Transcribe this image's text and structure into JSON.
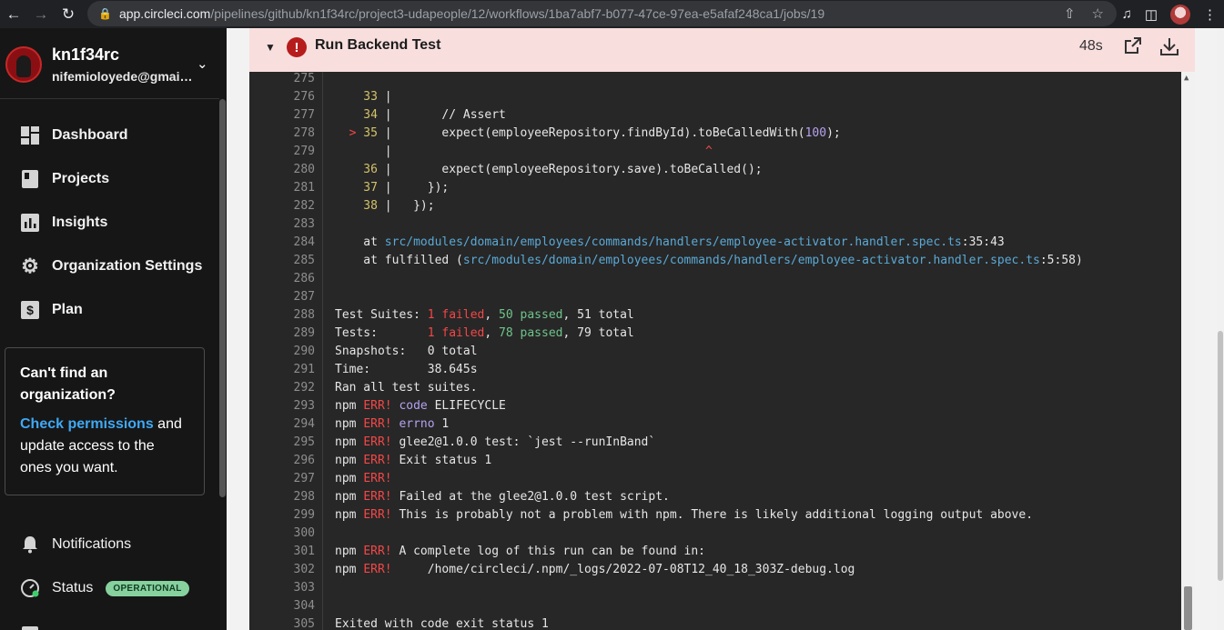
{
  "browser": {
    "url_host": "app.circleci.com",
    "url_path": "/pipelines/github/kn1f34rc/project3-udapeople/12/workflows/1ba7abf7-b077-47ce-97ea-e5afaf248ca1/jobs/19"
  },
  "sidebar": {
    "user_name": "kn1f34rc",
    "user_email": "nifemioloyede@gmail...",
    "nav": {
      "dashboard": "Dashboard",
      "projects": "Projects",
      "insights": "Insights",
      "org_settings": "Organization Settings",
      "plan": "Plan",
      "notifications": "Notifications",
      "status": "Status"
    },
    "org_box": {
      "heading": "Can't find an organization?",
      "link": "Check permissions",
      "text": " and update access to the ones you want."
    },
    "status_badge": "OPERATIONAL"
  },
  "job": {
    "title": "Run Backend Test",
    "duration": "48s"
  },
  "log": [
    {
      "n": "275",
      "segs": [
        {
          "t": ""
        }
      ]
    },
    {
      "n": "276",
      "segs": [
        {
          "t": "    33 ",
          "c": "c-yellow"
        },
        {
          "t": "|",
          "c": "c-dim"
        }
      ]
    },
    {
      "n": "277",
      "segs": [
        {
          "t": "    34 ",
          "c": "c-yellow"
        },
        {
          "t": "|",
          "c": "c-dim"
        },
        {
          "t": "       // Assert"
        }
      ]
    },
    {
      "n": "278",
      "segs": [
        {
          "t": "  ",
          "c": ""
        },
        {
          "t": ">",
          "c": "c-red"
        },
        {
          "t": " 35 ",
          "c": "c-yellow"
        },
        {
          "t": "|",
          "c": "c-dim"
        },
        {
          "t": "       expect(employeeRepository.findById).toBeCalledWith("
        },
        {
          "t": "100",
          "c": "c-purple"
        },
        {
          "t": ");"
        }
      ]
    },
    {
      "n": "279",
      "segs": [
        {
          "t": "       |",
          "c": "c-dim"
        },
        {
          "t": "                                            "
        },
        {
          "t": "^",
          "c": "c-red"
        }
      ]
    },
    {
      "n": "280",
      "segs": [
        {
          "t": "    36 ",
          "c": "c-yellow"
        },
        {
          "t": "|",
          "c": "c-dim"
        },
        {
          "t": "       expect(employeeRepository.save).toBeCalled();"
        }
      ]
    },
    {
      "n": "281",
      "segs": [
        {
          "t": "    37 ",
          "c": "c-yellow"
        },
        {
          "t": "|",
          "c": "c-dim"
        },
        {
          "t": "     });"
        }
      ]
    },
    {
      "n": "282",
      "segs": [
        {
          "t": "    38 ",
          "c": "c-yellow"
        },
        {
          "t": "|",
          "c": "c-dim"
        },
        {
          "t": "   });"
        }
      ]
    },
    {
      "n": "283",
      "segs": [
        {
          "t": ""
        }
      ]
    },
    {
      "n": "284",
      "segs": [
        {
          "t": "    at "
        },
        {
          "t": "src/modules/domain/employees/commands/handlers/employee-activator.handler.spec.ts",
          "c": "c-blue"
        },
        {
          "t": ":35:43"
        }
      ]
    },
    {
      "n": "285",
      "segs": [
        {
          "t": "    at fulfilled ("
        },
        {
          "t": "src/modules/domain/employees/commands/handlers/employee-activator.handler.spec.ts",
          "c": "c-blue"
        },
        {
          "t": ":5:58)"
        }
      ]
    },
    {
      "n": "286",
      "segs": [
        {
          "t": ""
        }
      ]
    },
    {
      "n": "287",
      "segs": [
        {
          "t": ""
        }
      ]
    },
    {
      "n": "288",
      "segs": [
        {
          "t": "Test Suites: "
        },
        {
          "t": "1 failed",
          "c": "c-red"
        },
        {
          "t": ", "
        },
        {
          "t": "50 passed",
          "c": "c-green"
        },
        {
          "t": ", 51 total"
        }
      ]
    },
    {
      "n": "289",
      "segs": [
        {
          "t": "Tests:       "
        },
        {
          "t": "1 failed",
          "c": "c-red"
        },
        {
          "t": ", "
        },
        {
          "t": "78 passed",
          "c": "c-green"
        },
        {
          "t": ", 79 total"
        }
      ]
    },
    {
      "n": "290",
      "segs": [
        {
          "t": "Snapshots:   0 total"
        }
      ]
    },
    {
      "n": "291",
      "segs": [
        {
          "t": "Time:        38.645s"
        }
      ]
    },
    {
      "n": "292",
      "segs": [
        {
          "t": "Ran all test suites."
        }
      ]
    },
    {
      "n": "293",
      "segs": [
        {
          "t": "npm "
        },
        {
          "t": "ERR!",
          "c": "c-red"
        },
        {
          "t": " "
        },
        {
          "t": "code",
          "c": "c-purple"
        },
        {
          "t": " ELIFECYCLE"
        }
      ]
    },
    {
      "n": "294",
      "segs": [
        {
          "t": "npm "
        },
        {
          "t": "ERR!",
          "c": "c-red"
        },
        {
          "t": " "
        },
        {
          "t": "errno",
          "c": "c-purple"
        },
        {
          "t": " 1"
        }
      ]
    },
    {
      "n": "295",
      "segs": [
        {
          "t": "npm "
        },
        {
          "t": "ERR!",
          "c": "c-red"
        },
        {
          "t": " glee2@1.0.0 test: `jest --runInBand`"
        }
      ]
    },
    {
      "n": "296",
      "segs": [
        {
          "t": "npm "
        },
        {
          "t": "ERR!",
          "c": "c-red"
        },
        {
          "t": " Exit status 1"
        }
      ]
    },
    {
      "n": "297",
      "segs": [
        {
          "t": "npm "
        },
        {
          "t": "ERR!",
          "c": "c-red"
        }
      ]
    },
    {
      "n": "298",
      "segs": [
        {
          "t": "npm "
        },
        {
          "t": "ERR!",
          "c": "c-red"
        },
        {
          "t": " Failed at the glee2@1.0.0 test script."
        }
      ]
    },
    {
      "n": "299",
      "segs": [
        {
          "t": "npm "
        },
        {
          "t": "ERR!",
          "c": "c-red"
        },
        {
          "t": " This is probably not a problem with npm. There is likely additional logging output above."
        }
      ]
    },
    {
      "n": "300",
      "segs": [
        {
          "t": ""
        }
      ]
    },
    {
      "n": "301",
      "segs": [
        {
          "t": "npm "
        },
        {
          "t": "ERR!",
          "c": "c-red"
        },
        {
          "t": " A complete log of this run can be found in:"
        }
      ]
    },
    {
      "n": "302",
      "segs": [
        {
          "t": "npm "
        },
        {
          "t": "ERR!",
          "c": "c-red"
        },
        {
          "t": "     /home/circleci/.npm/_logs/2022-07-08T12_40_18_303Z-debug.log"
        }
      ]
    },
    {
      "n": "303",
      "segs": [
        {
          "t": ""
        }
      ]
    },
    {
      "n": "304",
      "segs": [
        {
          "t": ""
        }
      ]
    },
    {
      "n": "305",
      "segs": [
        {
          "t": "Exited with code exit status 1"
        }
      ]
    }
  ]
}
